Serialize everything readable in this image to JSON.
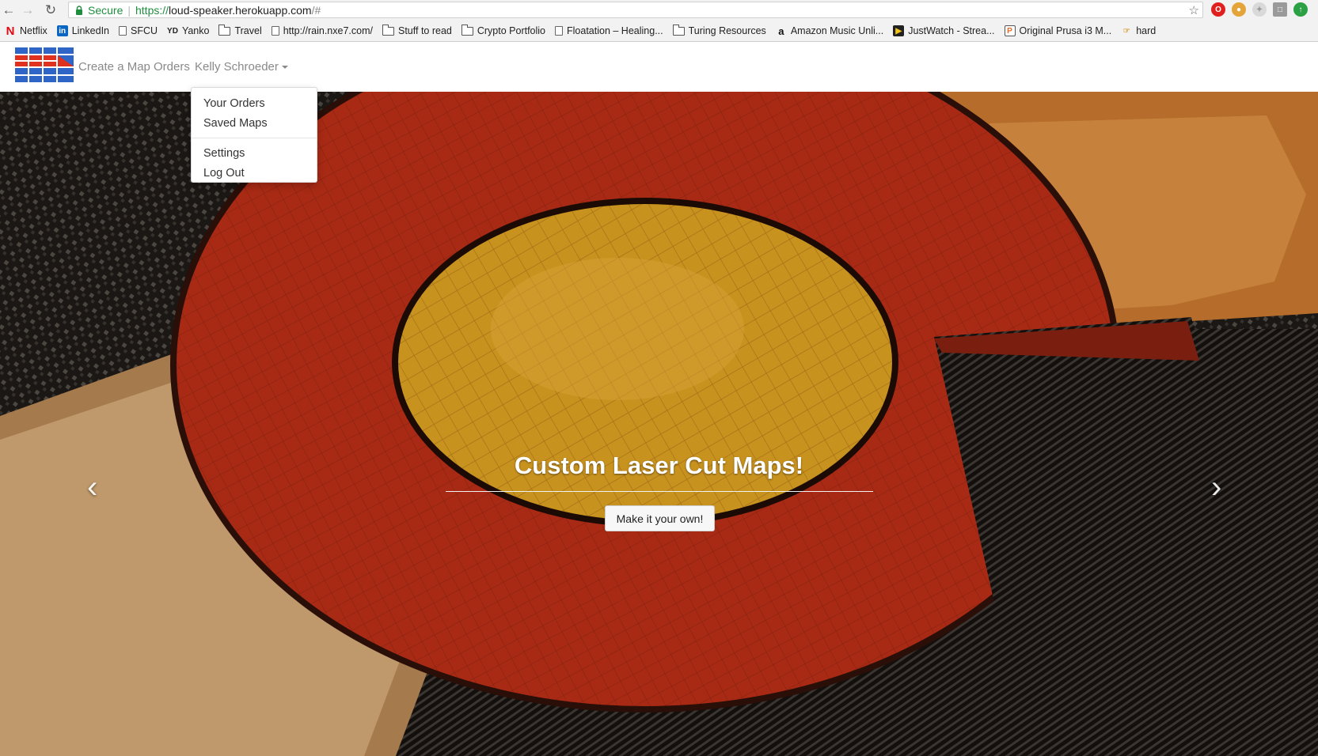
{
  "browser": {
    "secure_label": "Secure",
    "url_scheme": "https://",
    "url_host": "loud-speaker.herokuapp.com",
    "url_rest": "/#",
    "bookmarks": [
      {
        "label": "Netflix",
        "icon": "netflix-icon"
      },
      {
        "label": "LinkedIn",
        "icon": "linkedin-icon"
      },
      {
        "label": "SFCU",
        "icon": "page-icon"
      },
      {
        "label": "Yanko",
        "icon": "yanko-icon"
      },
      {
        "label": "Travel",
        "icon": "folder-icon"
      },
      {
        "label": "http://rain.nxe7.com/",
        "icon": "page-icon"
      },
      {
        "label": "Stuff to read",
        "icon": "folder-icon"
      },
      {
        "label": "Crypto Portfolio",
        "icon": "folder-icon"
      },
      {
        "label": "Floatation – Healing...",
        "icon": "page-icon"
      },
      {
        "label": "Turing Resources",
        "icon": "folder-icon"
      },
      {
        "label": "Amazon Music Unli...",
        "icon": "amazon-icon"
      },
      {
        "label": "JustWatch - Strea...",
        "icon": "justwatch-icon"
      },
      {
        "label": "Original Prusa i3 M...",
        "icon": "prusa-icon"
      },
      {
        "label": "hard",
        "icon": "hard-icon"
      }
    ],
    "yanko_badge": "YD"
  },
  "navbar": {
    "create_map": "Create a Map",
    "orders": "Orders",
    "user": "Kelly Schroeder"
  },
  "dropdown": {
    "items_top": [
      "Your Orders",
      "Saved Maps"
    ],
    "items_bottom": [
      "Settings",
      "Log Out"
    ]
  },
  "hero": {
    "title": "Custom Laser Cut Maps!",
    "cta": "Make it your own!",
    "prev_icon": "chevron-left-icon",
    "next_icon": "chevron-right-icon"
  },
  "colors": {
    "brand_blue": "#2f65c6",
    "brand_red": "#e0301e",
    "flag_red": "#b32a14",
    "flag_gold": "#c8921f",
    "secure_green": "#1e8e3e"
  }
}
